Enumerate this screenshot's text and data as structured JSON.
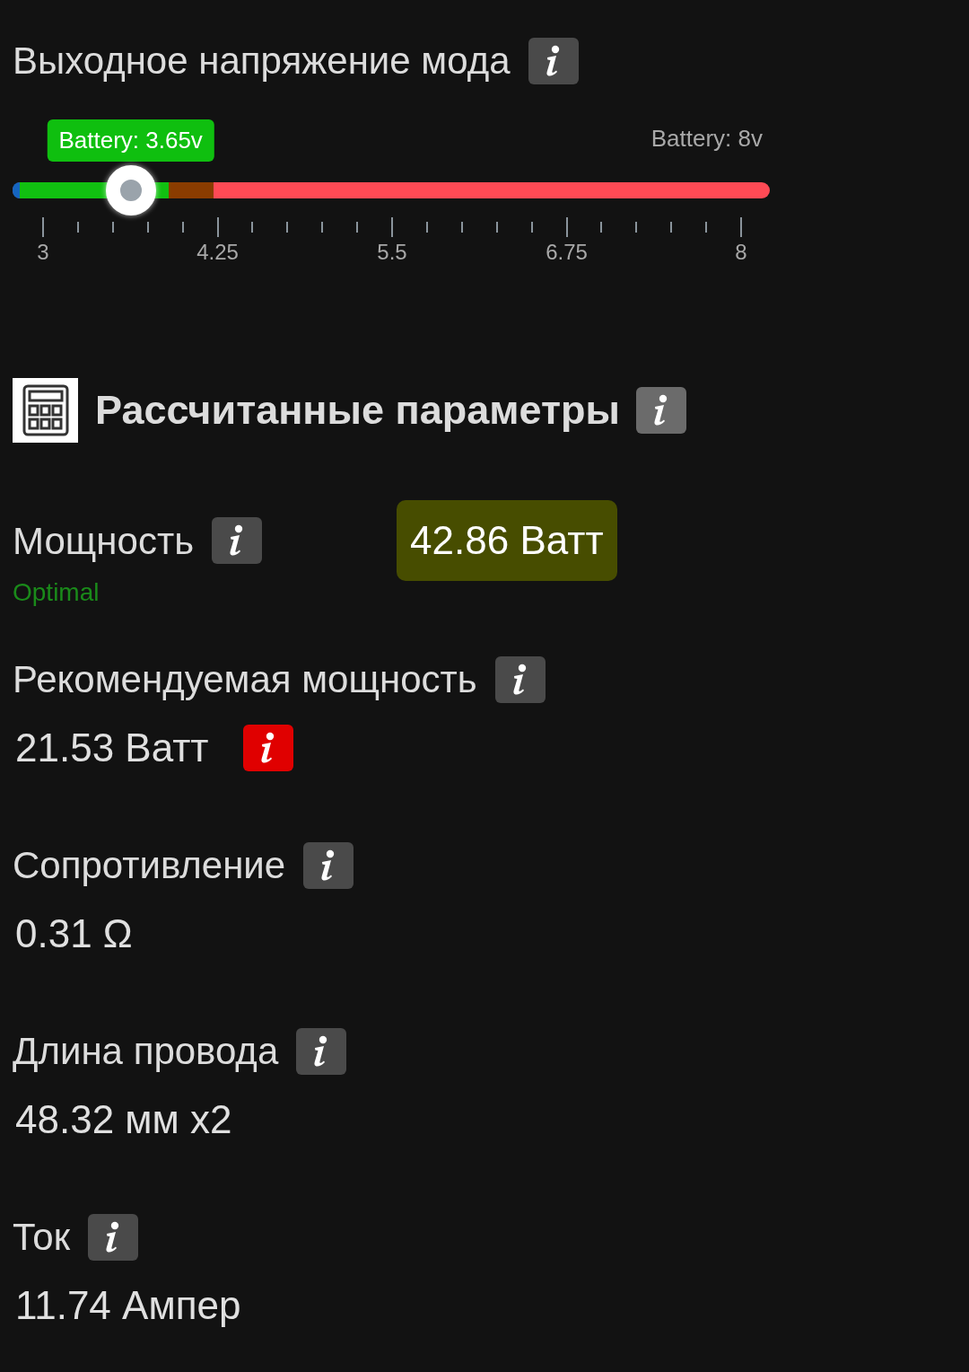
{
  "mode_voltage": {
    "title": "Выходное напряжение мода",
    "slider": {
      "level": 0.156,
      "current_label": "Battery: 3.65v",
      "max_label": "Battery: 8v",
      "ticks": [
        "3",
        "4.25",
        "5.5",
        "6.75",
        "8"
      ]
    }
  },
  "calculated": {
    "title": "Рассчитанные параметры",
    "params": [
      {
        "kind": "badge",
        "label": "Мощность",
        "value": "42.86 Ватт",
        "status": "Optimal",
        "warning": false
      },
      {
        "kind": "plain",
        "label": "Рекомендуемая мощность",
        "value": "21.53 Ватт",
        "warning": true
      },
      {
        "kind": "plain",
        "label": "Сопротивление",
        "value": "0.31 Ω",
        "warning": false
      },
      {
        "kind": "plain",
        "label": "Длина провода",
        "value": "48.32 мм x2",
        "warning": false
      },
      {
        "kind": "plain",
        "label": "Ток",
        "value": "11.74 Ампер",
        "warning": false
      }
    ]
  }
}
